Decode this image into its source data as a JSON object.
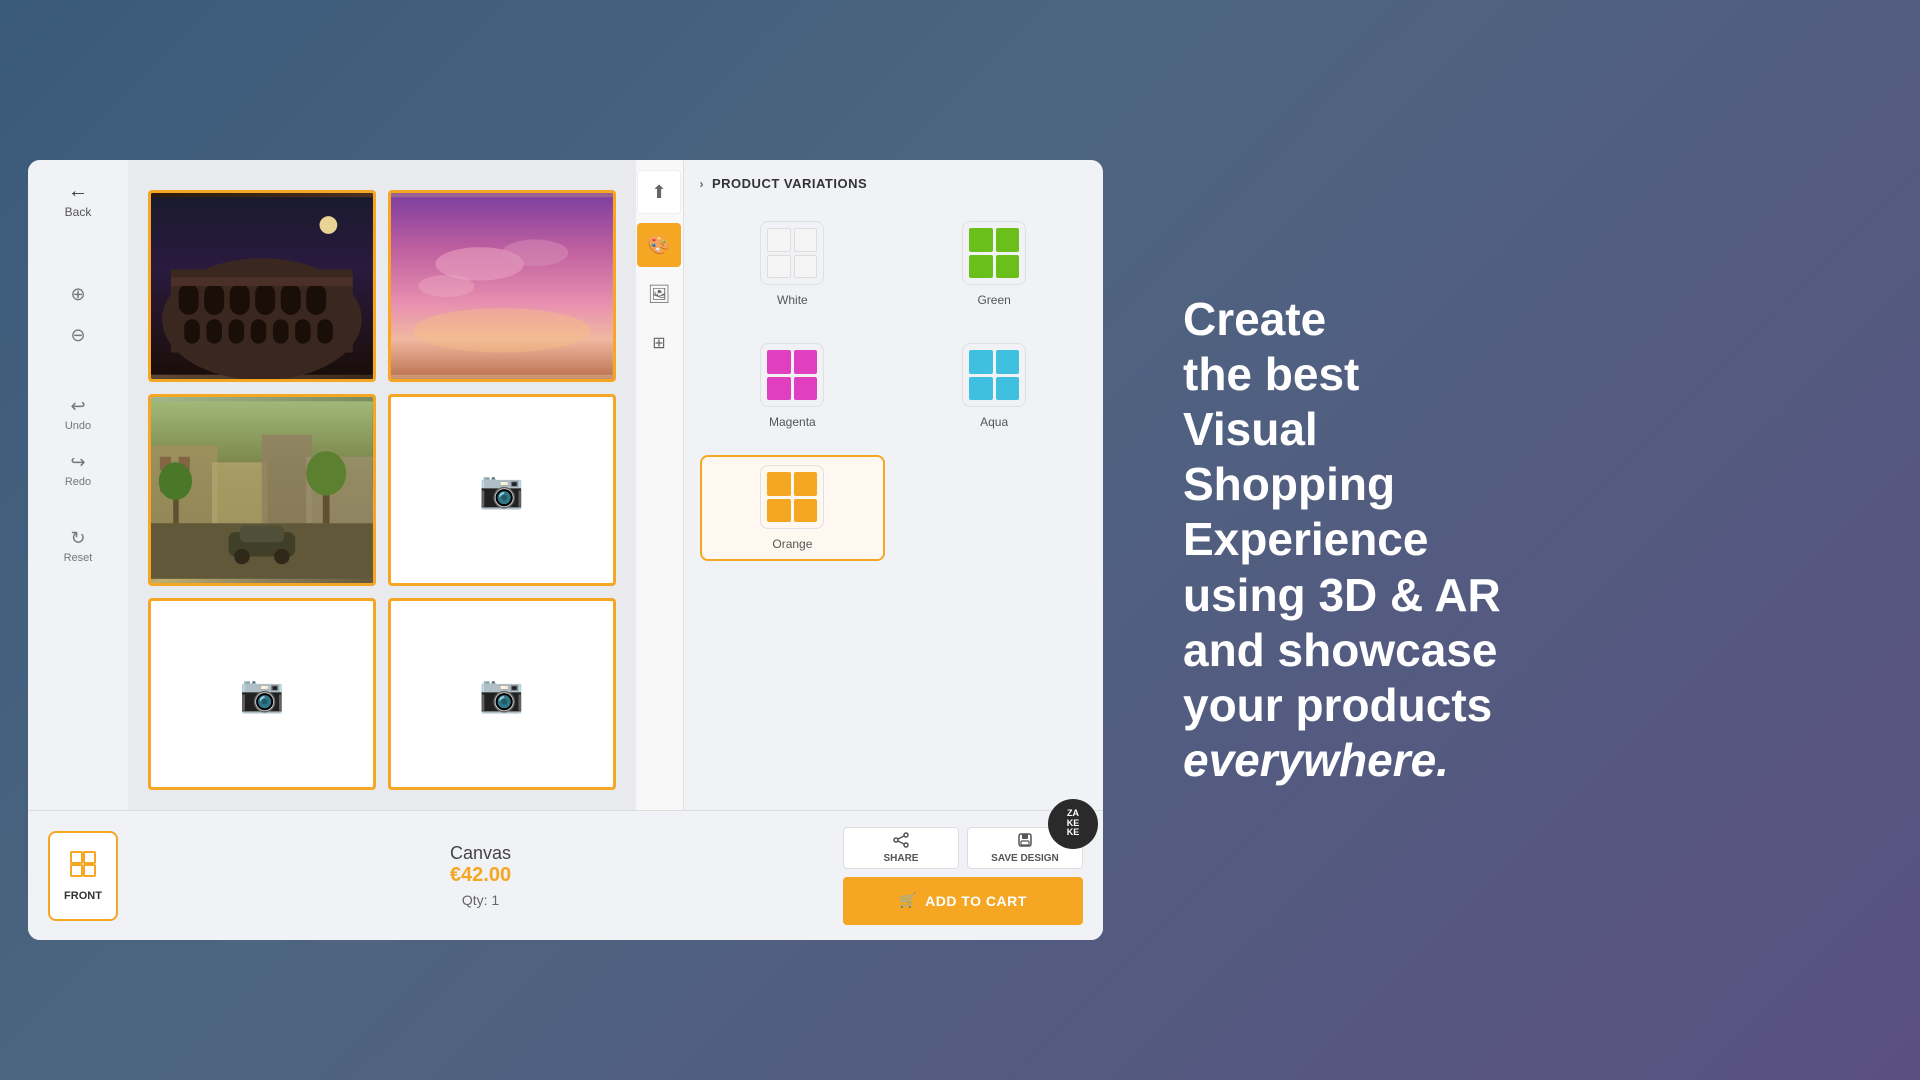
{
  "background": {
    "gradient_start": "#3a5a7a",
    "gradient_end": "#5a5080"
  },
  "app": {
    "back_label": "Back",
    "toolbar": {
      "zoom_in_label": "🔍",
      "zoom_out_label": "🔍",
      "undo_label": "Undo",
      "redo_label": "Redo",
      "reset_label": "Reset"
    },
    "canvas_cells": [
      {
        "id": 1,
        "type": "colosseum"
      },
      {
        "id": 2,
        "type": "pink_sky"
      },
      {
        "id": 3,
        "type": "street"
      },
      {
        "id": 4,
        "type": "empty"
      },
      {
        "id": 5,
        "type": "empty"
      },
      {
        "id": 6,
        "type": "empty"
      }
    ],
    "panel_toolbar": [
      {
        "id": "upload",
        "icon": "⬆",
        "active": false
      },
      {
        "id": "paint",
        "icon": "🎨",
        "active": true
      },
      {
        "id": "gallery",
        "icon": "🖼",
        "active": false
      },
      {
        "id": "grid",
        "icon": "⊞",
        "active": false
      }
    ],
    "variations": {
      "header": "PRODUCT VARIATIONS",
      "colors": [
        {
          "id": "white",
          "name": "White",
          "swatch_type": "white",
          "selected": false
        },
        {
          "id": "green",
          "name": "Green",
          "swatch_type": "green",
          "selected": false
        },
        {
          "id": "magenta",
          "name": "Magenta",
          "swatch_type": "magenta",
          "selected": false
        },
        {
          "id": "aqua",
          "name": "Aqua",
          "swatch_type": "aqua",
          "selected": false
        },
        {
          "id": "orange",
          "name": "Orange",
          "swatch_type": "orange",
          "selected": true
        }
      ]
    },
    "bottom": {
      "front_tab_label": "FRONT",
      "canvas_title": "Canvas",
      "canvas_price": "€42.00",
      "qty_label": "Qty: 1",
      "share_label": "SHARE",
      "save_design_label": "SAVE DESIGN",
      "add_to_cart_label": "ADD TO CART",
      "zakeke_label": "ZA\nKE\nKE"
    }
  },
  "promo": {
    "line1": "Create",
    "line2": "the best",
    "line3": "Visual",
    "line4": "Shopping",
    "line5": "Experience",
    "line6": "using 3D & AR",
    "line7": "and showcase",
    "line8": "your products",
    "line9_italic": "everywhere."
  }
}
